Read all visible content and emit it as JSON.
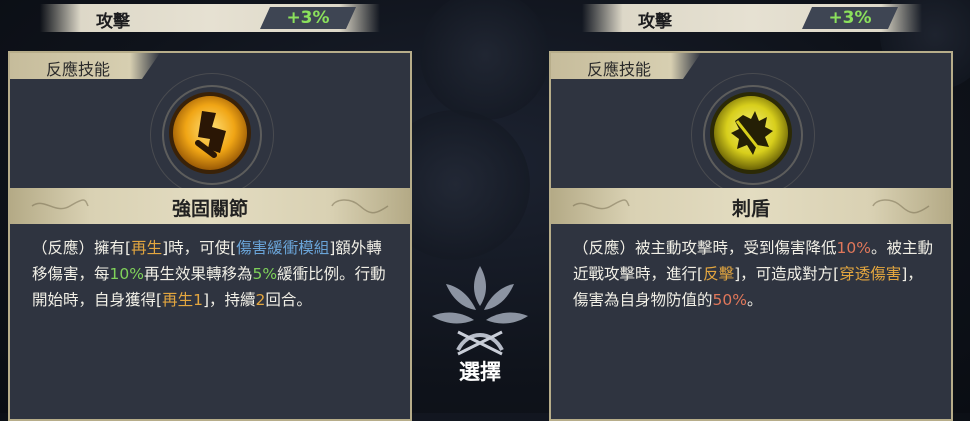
{
  "stat_left": {
    "label": "攻擊",
    "value": "+3%"
  },
  "stat_right": {
    "label": "攻擊",
    "value": "+3%"
  },
  "cards": [
    {
      "tag": "反應技能",
      "icon": "staff-sigil-icon",
      "name": "強固關節",
      "description": [
        {
          "t": "（反應）擁有[",
          "c": ""
        },
        {
          "t": "再生",
          "c": "o"
        },
        {
          "t": "]時，可使[",
          "c": ""
        },
        {
          "t": "傷害緩衝模組",
          "c": "b"
        },
        {
          "t": "]額外轉移傷害，每",
          "c": ""
        },
        {
          "t": "10%",
          "c": "g"
        },
        {
          "t": "再生效果轉移為",
          "c": ""
        },
        {
          "t": "5%",
          "c": "g"
        },
        {
          "t": "緩衝比例。行動開始時，自身獲得[",
          "c": ""
        },
        {
          "t": "再生1",
          "c": "o"
        },
        {
          "t": "]，持續",
          "c": ""
        },
        {
          "t": "2",
          "c": "o"
        },
        {
          "t": "回合。",
          "c": ""
        }
      ]
    },
    {
      "tag": "反應技能",
      "icon": "spiked-shield-icon",
      "name": "刺盾",
      "description": [
        {
          "t": "（反應）被主動攻擊時，受到傷害降低",
          "c": ""
        },
        {
          "t": "10%",
          "c": "r"
        },
        {
          "t": "。被主動近戰攻擊時，進行[",
          "c": ""
        },
        {
          "t": "反擊",
          "c": "o"
        },
        {
          "t": "]，可造成對方[",
          "c": ""
        },
        {
          "t": "穿透傷害",
          "c": "o"
        },
        {
          "t": "]，傷害為自身物防值的",
          "c": ""
        },
        {
          "t": "50%",
          "c": "r"
        },
        {
          "t": "。",
          "c": ""
        }
      ]
    }
  ],
  "select": {
    "label": "選擇",
    "icon": "leaf-crest-icon"
  },
  "colors": {
    "accent_green": "#7fd15a",
    "accent_orange": "#e3a63f",
    "accent_blue": "#6aa4d8",
    "accent_red": "#e0775a",
    "panel": "#2f3440",
    "trim": "#d9d1b3"
  }
}
